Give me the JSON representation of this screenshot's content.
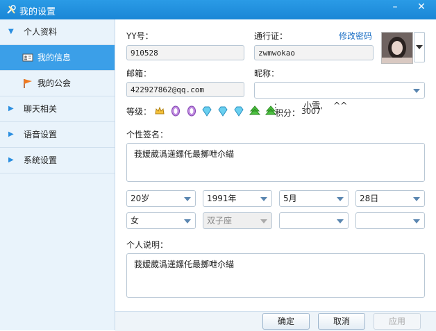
{
  "window": {
    "title": "我的设置",
    "min": "–",
    "close": "✕"
  },
  "sidebar": {
    "groups": [
      {
        "label": "个人资料",
        "expanded": true
      },
      {
        "label": "聊天相关",
        "expanded": false
      },
      {
        "label": "语音设置",
        "expanded": false
      },
      {
        "label": "系统设置",
        "expanded": false
      }
    ],
    "subitems": [
      {
        "label": "我的信息",
        "active": true
      },
      {
        "label": "我的公会",
        "active": false
      }
    ]
  },
  "profile": {
    "yy_label": "YY号：",
    "yy_value": "910528",
    "passport_label": "通行证：",
    "passport_value": "zwmwokao",
    "change_password": "修改密码",
    "email_label": "邮箱：",
    "email_value": "422927862@qq.com",
    "nickname_label": "昵称：",
    "nickname_value": "  :          小雪,    ^^",
    "level_label": "等级：",
    "points_label": "积分：",
    "points_value": "3007",
    "signature_label": "个性签名：",
    "signature_value": "莪嫒葳潙遳鏍仛最擲呭尒緢",
    "age_value": "20岁",
    "year_value": "1991年",
    "month_value": "5月",
    "day_value": "28日",
    "gender_value": "女",
    "zodiac_value": "双子座",
    "blank1_value": "",
    "blank2_value": "",
    "description_label": "个人说明：",
    "description_value": "莪嫒葳潙遳鏍仛最擲呭尒緢"
  },
  "footer": {
    "ok": "确定",
    "cancel": "取消",
    "apply": "应用"
  }
}
